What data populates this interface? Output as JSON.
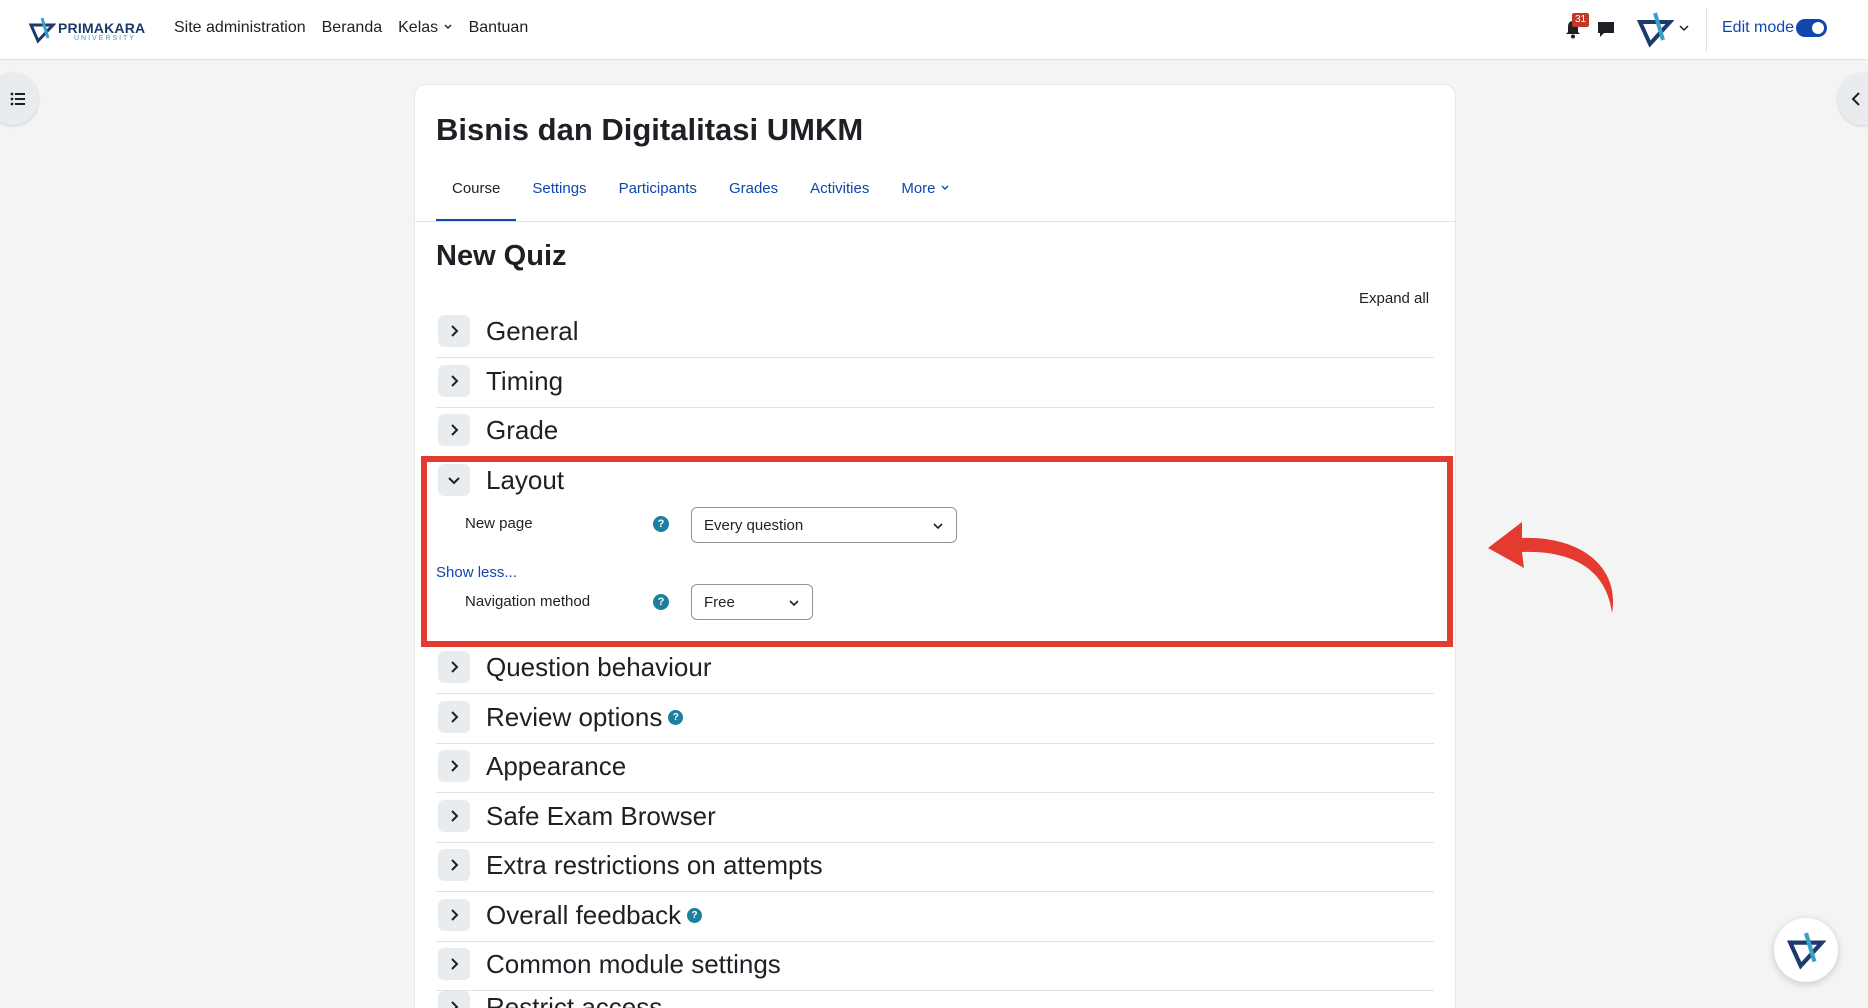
{
  "brand": {
    "name": "PRIMAKARA",
    "sub": "UNIVERSITY"
  },
  "nav": {
    "links": [
      "Site administration",
      "Beranda",
      "Kelas",
      "Bantuan"
    ],
    "notifications_count": "31",
    "edit_mode_label": "Edit mode",
    "edit_mode_on": true
  },
  "course": {
    "title": "Bisnis dan Digitalitasi UMKM",
    "tabs": [
      "Course",
      "Settings",
      "Participants",
      "Grades",
      "Activities",
      "More"
    ],
    "active_tab": "Course"
  },
  "page": {
    "title": "New Quiz",
    "expand_all": "Expand all"
  },
  "sections": {
    "general": "General",
    "timing": "Timing",
    "grade": "Grade",
    "layout": "Layout",
    "question_behaviour": "Question behaviour",
    "review_options": "Review options",
    "appearance": "Appearance",
    "safe_exam_browser": "Safe Exam Browser",
    "extra_restrictions": "Extra restrictions on attempts",
    "overall_feedback": "Overall feedback",
    "common_module_settings": "Common module settings",
    "restrict_access": "Restrict access"
  },
  "layout_form": {
    "new_page_label": "New page",
    "new_page_value": "Every question",
    "show_less": "Show less...",
    "navigation_label": "Navigation method",
    "navigation_value": "Free"
  },
  "colors": {
    "accent": "#0f47ad",
    "highlight": "#e43a2f",
    "help": "#1c7fa0"
  }
}
